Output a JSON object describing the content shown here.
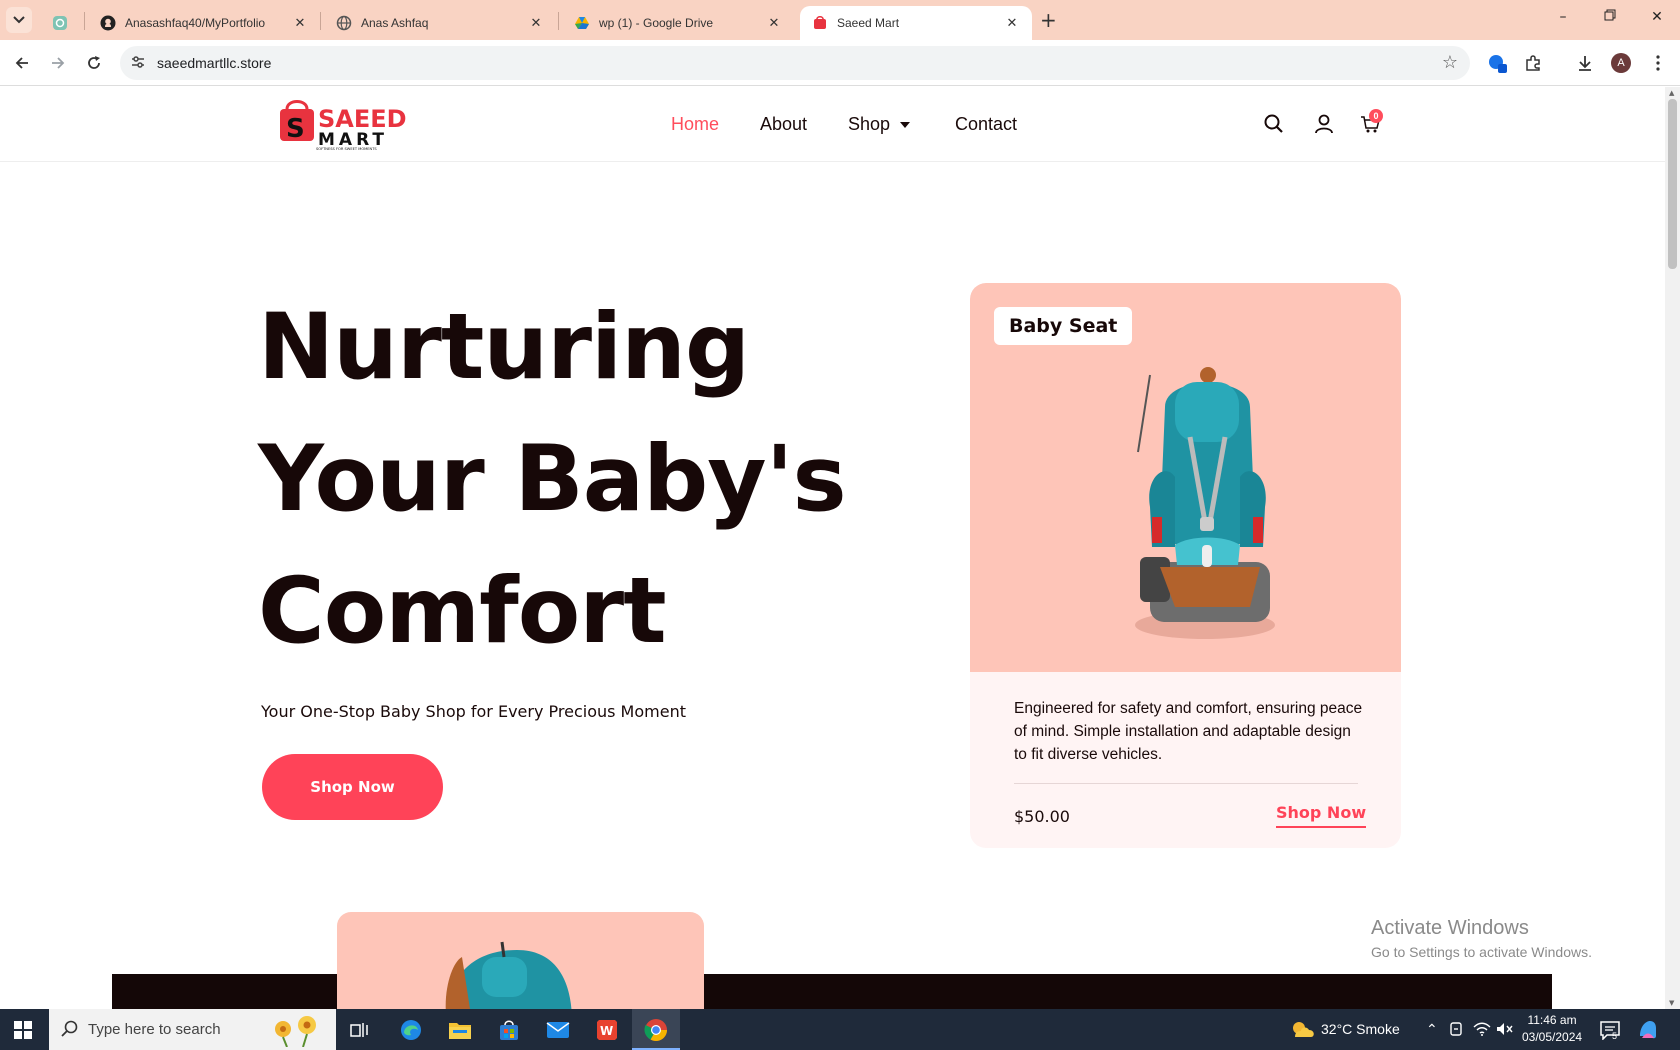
{
  "browser": {
    "tabs": [
      {
        "title": "",
        "icon": "chatgpt-icon"
      },
      {
        "title": "Anasashfaq40/MyPortfolio",
        "icon": "github-icon"
      },
      {
        "title": "Anas Ashfaq",
        "icon": "globe-icon"
      },
      {
        "title": "wp (1) - Google Drive",
        "icon": "google-drive-icon"
      },
      {
        "title": "Saeed Mart",
        "icon": "saeed-mart-favicon",
        "active": true
      }
    ],
    "url": "saeedmartllc.store",
    "profile_initial": "A"
  },
  "site": {
    "logo_alt": "Saeed Mart",
    "logo_top": "SAEED",
    "logo_bottom": "MART",
    "logo_tagline": "SOFTNESS FOR SWEET MOMENTS",
    "nav": {
      "home": "Home",
      "about": "About",
      "shop": "Shop",
      "contact": "Contact"
    },
    "cart_count": "0"
  },
  "hero": {
    "title_line1": "Nurturing",
    "title_line2": "Your Baby's",
    "title_line3": "Comfort",
    "subtitle": "Your One-Stop Baby Shop for Every Precious Moment",
    "cta": "Shop Now"
  },
  "product_card": {
    "tag": "Baby Seat",
    "description": "Engineered for safety and comfort, ensuring peace of mind. Simple installation and adaptable design to fit diverse vehicles.",
    "price": "$50.00",
    "cta": "Shop Now"
  },
  "watermark": {
    "line1": "Activate Windows",
    "line2": "Go to Settings to activate Windows."
  },
  "taskbar": {
    "search_placeholder": "Type here to search",
    "weather": "32°C  Smoke",
    "time": "11:46 am",
    "date": "03/05/2024",
    "notifications": "5"
  },
  "colors": {
    "accent": "#ff4358",
    "card_peach": "#fec5b8",
    "tabstrip": "#f9d3c3",
    "dark": "#140707"
  }
}
